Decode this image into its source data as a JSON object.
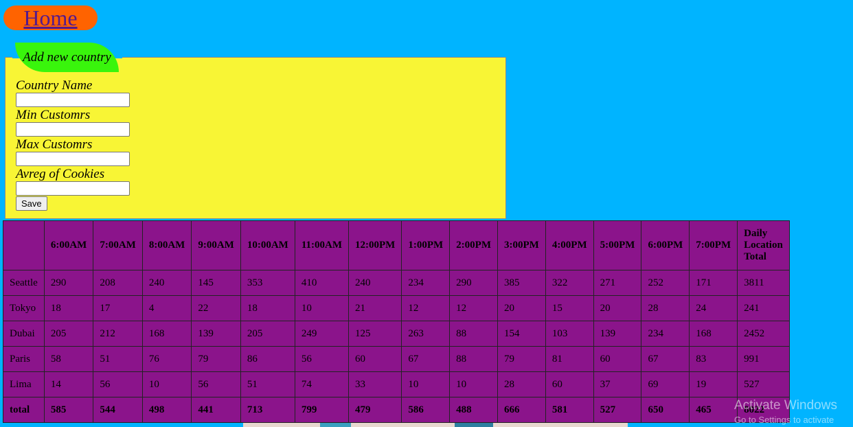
{
  "nav": {
    "home_label": "Home"
  },
  "form": {
    "legend": "Add new country",
    "fields": [
      {
        "label": "Country Name",
        "value": ""
      },
      {
        "label": "Min Customrs",
        "value": ""
      },
      {
        "label": "Max Customrs",
        "value": ""
      },
      {
        "label": "Avreg of Cookies",
        "value": ""
      }
    ],
    "save_label": "Save"
  },
  "table": {
    "corner": "",
    "headers": [
      "6:00AM",
      "7:00AM",
      "8:00AM",
      "9:00AM",
      "10:00AM",
      "11:00AM",
      "12:00PM",
      "1:00PM",
      "2:00PM",
      "3:00PM",
      "4:00PM",
      "5:00PM",
      "6:00PM",
      "7:00PM",
      "Daily Location Total"
    ],
    "rows": [
      {
        "name": "Seattle",
        "values": [
          "290",
          "208",
          "240",
          "145",
          "353",
          "410",
          "240",
          "234",
          "290",
          "385",
          "322",
          "271",
          "252",
          "171",
          "3811"
        ]
      },
      {
        "name": "Tokyo",
        "values": [
          "18",
          "17",
          "4",
          "22",
          "18",
          "10",
          "21",
          "12",
          "12",
          "20",
          "15",
          "20",
          "28",
          "24",
          "241"
        ]
      },
      {
        "name": "Dubai",
        "values": [
          "205",
          "212",
          "168",
          "139",
          "205",
          "249",
          "125",
          "263",
          "88",
          "154",
          "103",
          "139",
          "234",
          "168",
          "2452"
        ]
      },
      {
        "name": "Paris",
        "values": [
          "58",
          "51",
          "76",
          "79",
          "86",
          "56",
          "60",
          "67",
          "88",
          "79",
          "81",
          "60",
          "67",
          "83",
          "991"
        ]
      },
      {
        "name": "Lima",
        "values": [
          "14",
          "56",
          "10",
          "56",
          "51",
          "74",
          "33",
          "10",
          "10",
          "28",
          "60",
          "37",
          "69",
          "19",
          "527"
        ]
      }
    ],
    "total": {
      "name": "total",
      "values": [
        "585",
        "544",
        "498",
        "441",
        "713",
        "799",
        "479",
        "586",
        "488",
        "666",
        "581",
        "527",
        "650",
        "465",
        "8022"
      ]
    }
  },
  "watermark": {
    "title": "Activate Windows",
    "subtitle": "Go to Settings to activate"
  },
  "colors": {
    "background": "#00b4ff",
    "home_button": "#ff6300",
    "form_panel": "#f8f535",
    "legend": "#39f50c",
    "table": "#8b148b"
  }
}
